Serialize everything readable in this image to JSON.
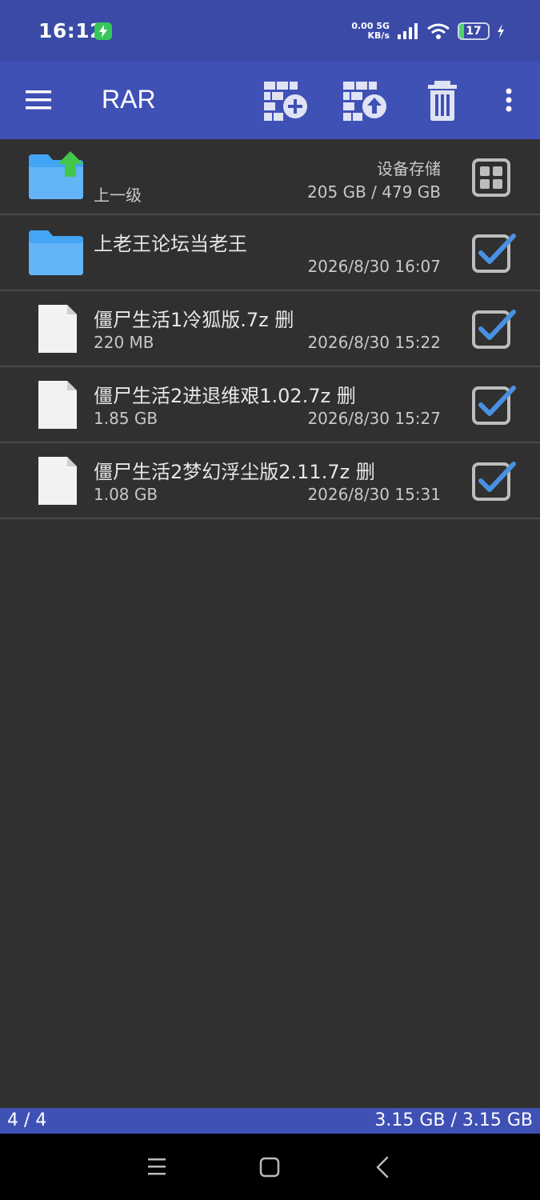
{
  "status_bar": {
    "time": "16:12",
    "net_speed_value": "0.00",
    "net_speed_unit": "KB/s",
    "network_type": "5G",
    "battery": "17",
    "battery_level": 0.17,
    "colors": {
      "bar": "#3a4aa6",
      "charge": "#35c759"
    }
  },
  "toolbar": {
    "title": "RAR",
    "icons": [
      "menu-icon",
      "add-to-archive-icon",
      "extract-archive-icon",
      "trash-icon",
      "more-vert-icon"
    ]
  },
  "files": [
    {
      "name": "上一级",
      "info": "205 GB / 479 GB",
      "label": "设备存储",
      "icon": "folder-up-icon",
      "selected": false
    },
    {
      "name": "上老王论坛当老王",
      "info": "",
      "date": "2026/8/30 16:07",
      "icon": "folder-icon",
      "selected": true
    },
    {
      "name": "僵尸生活1冷狐版.7z 删",
      "info": "220 MB",
      "date": "2026/8/30 15:22",
      "icon": "file-icon",
      "selected": true
    },
    {
      "name": "僵尸生活2进退维艰1.02.7z 删",
      "info": "1.85 GB",
      "date": "2026/8/30 15:27",
      "icon": "file-icon",
      "selected": true
    },
    {
      "name": "僵尸生活2梦幻浮尘版2.11.7z 删",
      "info": "1.08 GB",
      "date": "2026/8/30 15:31",
      "icon": "file-icon",
      "selected": true
    }
  ],
  "footer": {
    "selection_count": "4 / 4",
    "selection_size": "3.15 GB / 3.15 GB"
  },
  "nav": {
    "icons": [
      "recents-icon",
      "home-icon",
      "back-icon"
    ]
  },
  "colors": {
    "app_bar": "#3f51b5",
    "background": "#303030",
    "folder": "#42a5f5",
    "up_arrow": "#43c74b",
    "check": "#4a90e2"
  }
}
